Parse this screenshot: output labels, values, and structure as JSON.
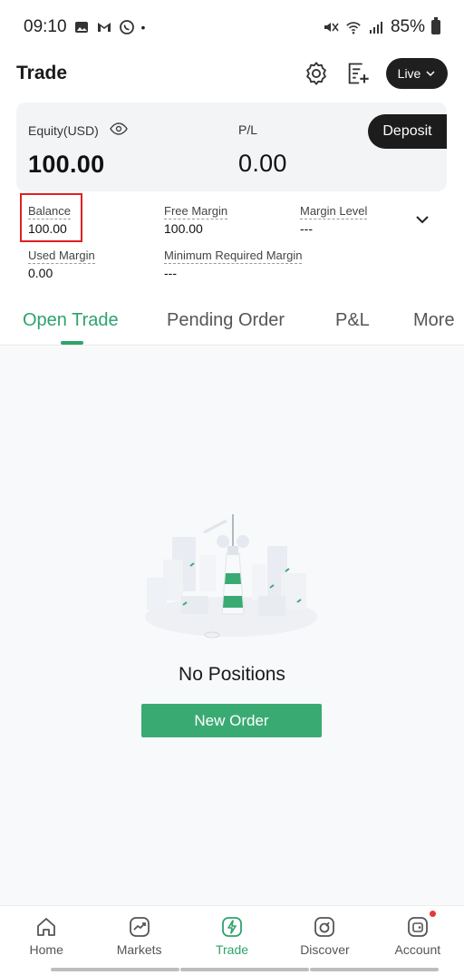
{
  "status_bar": {
    "time": "09:10",
    "battery": "85%",
    "dot": "•"
  },
  "header": {
    "title": "Trade",
    "live_label": "Live"
  },
  "account": {
    "equity_label": "Equity(USD)",
    "equity_value": "100.00",
    "pl_label": "P/L",
    "pl_value": "0.00",
    "deposit_label": "Deposit"
  },
  "metrics": {
    "balance_label": "Balance",
    "balance_value": "100.00",
    "free_margin_label": "Free Margin",
    "free_margin_value": "100.00",
    "margin_level_label": "Margin Level",
    "margin_level_value": "---",
    "used_margin_label": "Used Margin",
    "used_margin_value": "0.00",
    "min_required_label": "Minimum Required Margin",
    "min_required_value": "---"
  },
  "tabs": [
    {
      "label": "Open Trade",
      "active": true
    },
    {
      "label": "Pending Order",
      "active": false
    },
    {
      "label": "P&L",
      "active": false
    },
    {
      "label": "More",
      "active": false
    }
  ],
  "empty_state": {
    "message": "No Positions",
    "button_label": "New Order"
  },
  "bottom_nav": [
    {
      "label": "Home",
      "icon": "home-icon"
    },
    {
      "label": "Markets",
      "icon": "markets-icon"
    },
    {
      "label": "Trade",
      "icon": "trade-icon",
      "active": true
    },
    {
      "label": "Discover",
      "icon": "discover-icon"
    },
    {
      "label": "Account",
      "icon": "account-icon",
      "badge": true
    }
  ],
  "colors": {
    "accent": "#2fa36b",
    "button": "#3aaa73",
    "dark": "#1c1c1c",
    "highlight": "#e02020"
  }
}
